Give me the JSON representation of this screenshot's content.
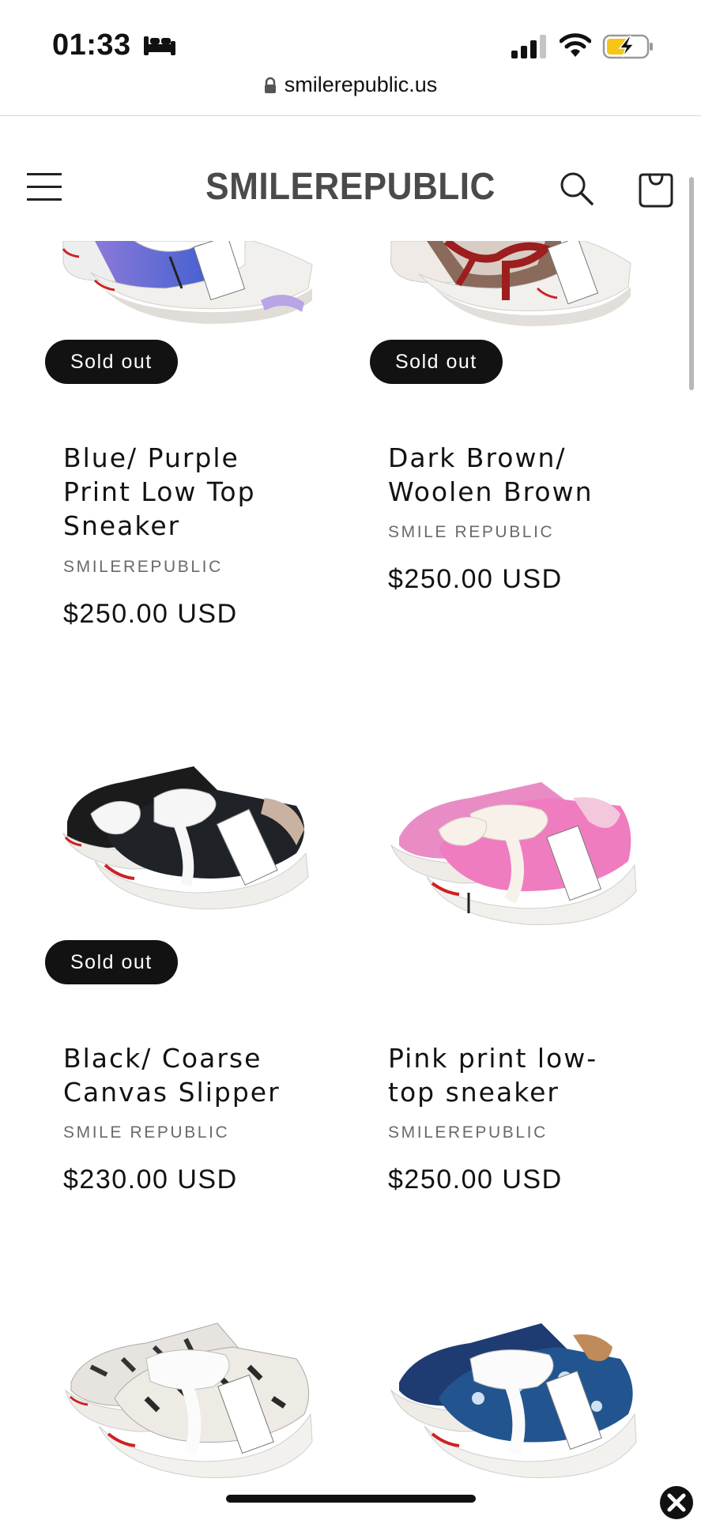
{
  "status_bar": {
    "time": "01:33",
    "url": "smilerepublic.us"
  },
  "header": {
    "brand": "SMILEREPUBLIC"
  },
  "products": [
    {
      "title_lines": [
        "Blue/ Purple",
        "Print Low Top",
        "Sneaker"
      ],
      "vendor": "SMILEREPUBLIC",
      "price": "$250.00 USD",
      "badge": "Sold out"
    },
    {
      "title_lines": [
        "Dark Brown/",
        "Woolen Brown"
      ],
      "vendor": "SMILE REPUBLIC",
      "price": "$250.00 USD",
      "badge": "Sold out"
    },
    {
      "title_lines": [
        "Black/ Coarse",
        "Canvas Slipper"
      ],
      "vendor": "SMILE REPUBLIC",
      "price": "$230.00 USD",
      "badge": "Sold out"
    },
    {
      "title_lines": [
        "Pink print low-",
        "top sneaker"
      ],
      "vendor": "SMILEREPUBLIC",
      "price": "$250.00 USD",
      "badge": null
    },
    {
      "title_lines": [],
      "vendor": null,
      "price": null,
      "badge": null
    },
    {
      "title_lines": [],
      "vendor": null,
      "price": null,
      "badge": null
    }
  ],
  "colors": {
    "text": "#121212",
    "badge_bg": "#121212",
    "vendor": "#6a6a6a",
    "brand": "#4a4a4a",
    "battery_fill": "#f5c518"
  },
  "icons": [
    "sleep-icon",
    "signal-icon",
    "wifi-icon",
    "battery-charging-icon",
    "lock-icon",
    "menu-icon",
    "search-icon",
    "cart-icon",
    "close-icon"
  ]
}
